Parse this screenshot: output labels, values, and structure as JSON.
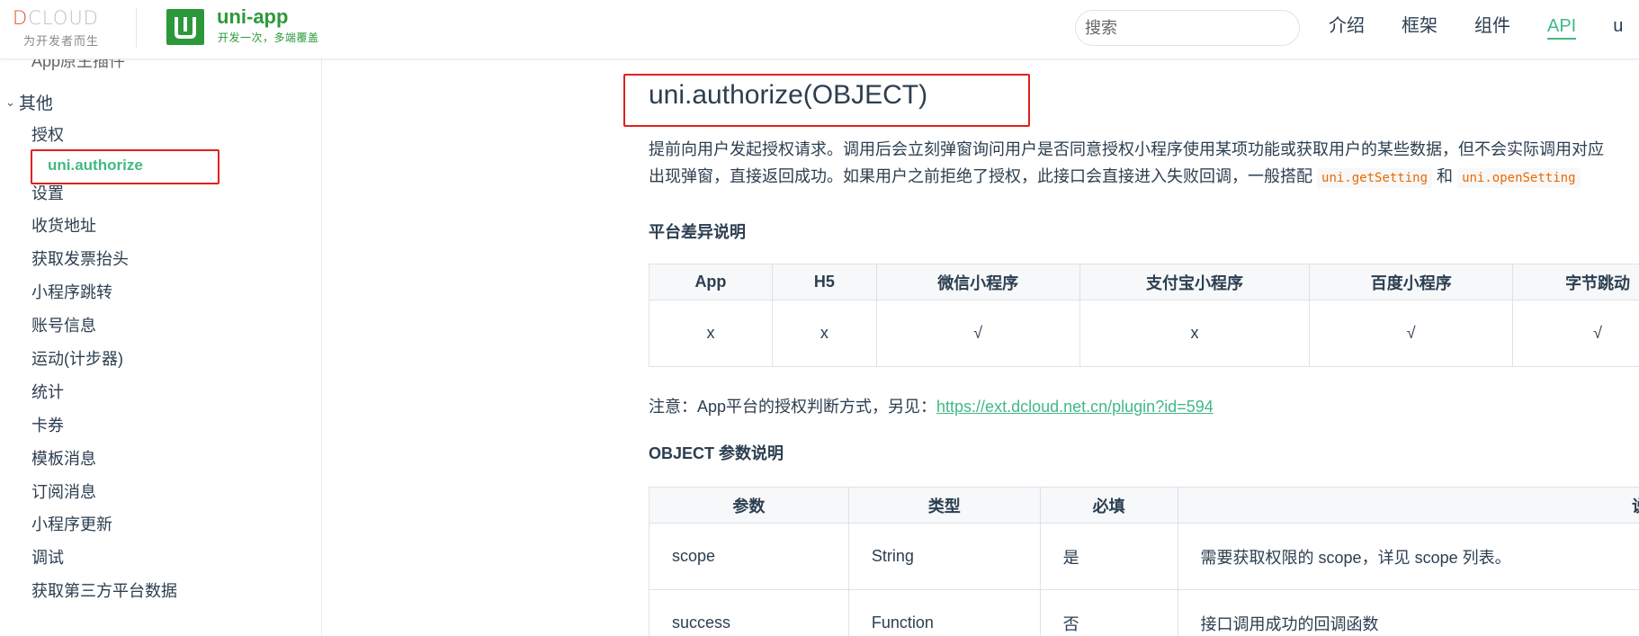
{
  "header": {
    "dcloud_logo_text": "DCLOUD",
    "dcloud_tagline": "为开发者而生",
    "uni_logo_letter": "U",
    "uni_name": "uni-app",
    "uni_slogan": "开发一次，多端覆盖",
    "search_placeholder": "搜索",
    "nav": [
      "介绍",
      "框架",
      "组件",
      "API",
      "u"
    ],
    "nav_active": "API",
    "accent_color": "#42b983",
    "brand_color": "#2b9939"
  },
  "sidebar": {
    "partial_top_item": "App原生插件",
    "group_label": "其他",
    "group_expanded": true,
    "items": [
      "授权",
      "uni.authorize",
      "设置",
      "收货地址",
      "获取发票抬头",
      "小程序跳转",
      "账号信息",
      "运动(计步器)",
      "统计",
      "卡券",
      "模板消息",
      "订阅消息",
      "小程序更新",
      "调试",
      "获取第三方平台数据"
    ],
    "active_item": "uni.authorize",
    "highlight_color": "#e02020"
  },
  "content": {
    "title": "uni.authorize(OBJECT)",
    "description_line1": "提前向用户发起授权请求。调用后会立刻弹窗询问用户是否同意授权小程序使用某项功能或获取用户的某些数据，但不会实际调用对应",
    "description_line2_prefix": "出现弹窗，直接返回成功。如果用户之前拒绝了授权，此接口会直接进入失败回调，一般搭配",
    "code_1": "uni.getSetting",
    "and_text": "和",
    "code_2": "uni.openSetting",
    "platform_heading": "平台差异说明",
    "platform_table": {
      "headers": [
        "App",
        "H5",
        "微信小程序",
        "支付宝小程序",
        "百度小程序",
        "字节跳动"
      ],
      "row": [
        "x",
        "x",
        "√",
        "x",
        "√",
        "√"
      ]
    },
    "note_prefix": "注意：App平台的授权判断方式，另见：",
    "note_link": "https://ext.dcloud.net.cn/plugin?id=594",
    "params_heading": "OBJECT 参数说明",
    "params_table": {
      "headers": [
        "参数",
        "类型",
        "必填",
        "说明"
      ],
      "rows": [
        [
          "scope",
          "String",
          "是",
          "需要获取权限的 scope，详见 scope 列表。"
        ],
        [
          "success",
          "Function",
          "否",
          "接口调用成功的回调函数"
        ]
      ]
    }
  }
}
